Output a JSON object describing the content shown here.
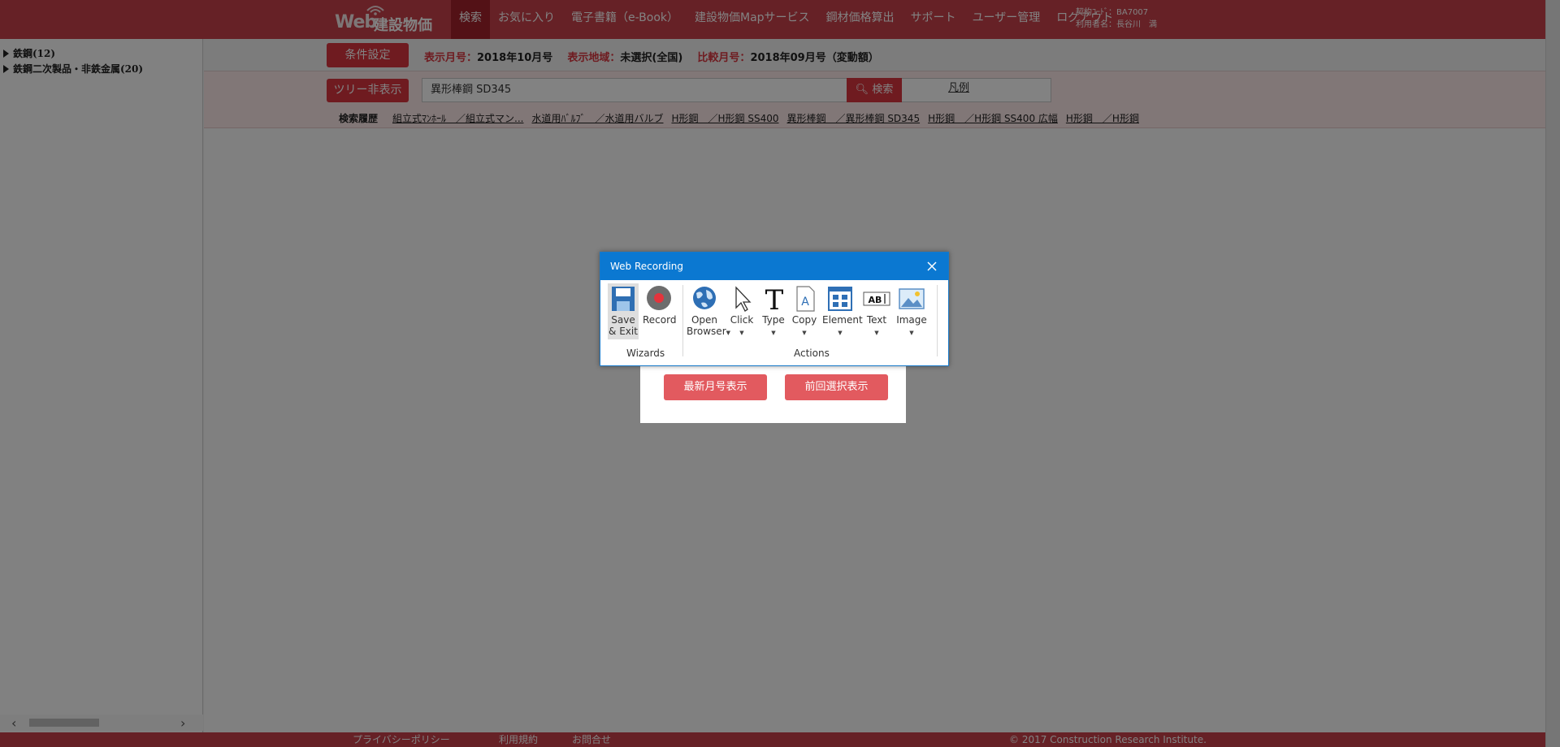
{
  "header": {
    "logo_web": "Web",
    "logo_name": "建設物価",
    "nav": [
      "検索",
      "お気に入り",
      "電子書籍（e-Book）",
      "建設物価Mapサービス",
      "鋼材価格算出",
      "サポート",
      "ユーザー管理",
      "ログアウト"
    ],
    "active_nav": "検索",
    "contract_code": "契約ｺｰﾄﾞ：BA7007",
    "user_name": "利用者名：長谷川　満"
  },
  "sidebar": {
    "items": [
      {
        "label": "鉄鋼(12)"
      },
      {
        "label": "鉄鋼二次製品・非鉄金属(20)"
      }
    ]
  },
  "panel": {
    "condition_button": "条件設定",
    "display_month_label": "表示月号：",
    "display_month_value": "2018年10月号",
    "region_label": "表示地域：",
    "region_value": "未選択(全国)",
    "compare_label": "比較月号：",
    "compare_value": "2018年09月号（変動額）",
    "tree_toggle_button": "ツリー非表示",
    "search_value": "異形棒鋼 SD345",
    "search_button": "検索",
    "legend_link": "凡例",
    "history_label": "検索履歴",
    "history": [
      "組立式ﾏﾝﾎｰﾙ　／組立式マン...",
      "水道用ﾊﾞﾙﾌﾞ　／水道用バルブ",
      "H形鋼　／H形鋼 SS400",
      "異形棒鋼　／異形棒鋼 SD345",
      "H形鋼　／H形鋼 SS400 広幅",
      "H形鋼　／H形鋼"
    ]
  },
  "dialog": {
    "latest_button": "最新月号表示",
    "previous_button": "前回選択表示"
  },
  "recorder": {
    "title": "Web Recording",
    "tools": {
      "save": "Save & Exit",
      "record": "Record",
      "open_browser": "Open Browser",
      "click": "Click",
      "type": "Type",
      "copy": "Copy",
      "element": "Element",
      "text": "Text",
      "image": "Image"
    },
    "groups": {
      "wizards": "Wizards",
      "actions": "Actions"
    }
  },
  "footer": {
    "privacy": "プライバシーポリシー",
    "terms": "利用規約",
    "contact": "お問合せ",
    "copyright": "© 2017 Construction Research Institute."
  },
  "colors": {
    "brand_red": "#c9424b",
    "accent_blue": "#0b78d1"
  }
}
